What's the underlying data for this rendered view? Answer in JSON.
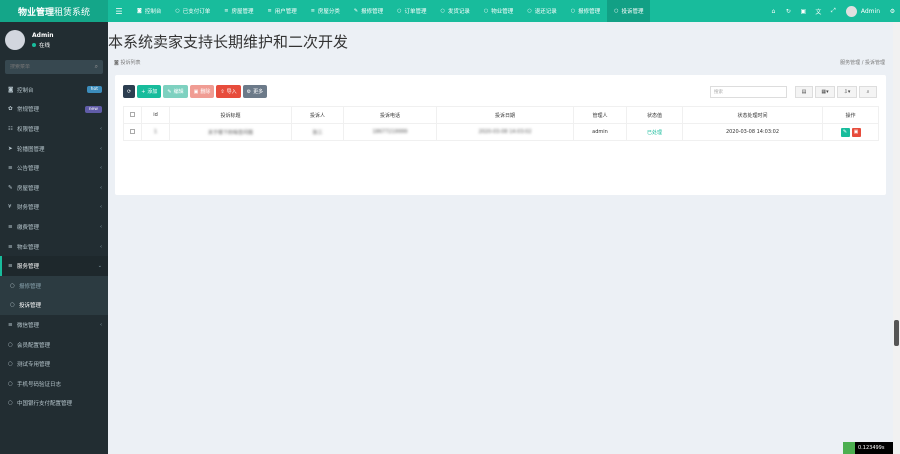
{
  "brand": {
    "bold": "物业管理",
    "light": "租赁系统"
  },
  "topnav": [
    {
      "label": "控制台",
      "icon": "dashboard-icon",
      "glyph": "◙",
      "active": false
    },
    {
      "label": "已支付订单",
      "icon": "circle-icon",
      "glyph": "○",
      "active": false
    },
    {
      "label": "房屋管理",
      "icon": "list-icon",
      "glyph": "≡",
      "active": false
    },
    {
      "label": "用户管理",
      "icon": "list-icon",
      "glyph": "≡",
      "active": false
    },
    {
      "label": "房屋分类",
      "icon": "list-icon",
      "glyph": "≡",
      "active": false
    },
    {
      "label": "报修管理",
      "icon": "wrench-icon",
      "glyph": "✎",
      "active": false
    },
    {
      "label": "订单管理",
      "icon": "circle-icon",
      "glyph": "○",
      "active": false
    },
    {
      "label": "发货记录",
      "icon": "circle-icon",
      "glyph": "○",
      "active": false
    },
    {
      "label": "物业管理",
      "icon": "circle-icon",
      "glyph": "○",
      "active": false
    },
    {
      "label": "退还记录",
      "icon": "circle-icon",
      "glyph": "○",
      "active": false
    },
    {
      "label": "报修管理",
      "icon": "circle-icon",
      "glyph": "○",
      "active": false
    },
    {
      "label": "投诉管理",
      "icon": "circle-icon",
      "glyph": "○",
      "active": true
    }
  ],
  "topright": {
    "username": "Admin"
  },
  "user": {
    "name": "Admin",
    "status": "在线"
  },
  "sidebar_search": {
    "placeholder": "搜索菜单"
  },
  "menu": [
    {
      "label": "控制台",
      "icon": "dashboard-icon",
      "glyph": "◙",
      "badge": "hot",
      "badge_color": "#3c8dbc"
    },
    {
      "label": "常规管理",
      "icon": "cogs-icon",
      "glyph": "✿",
      "badge": "new",
      "badge_color": "#605ca8"
    },
    {
      "label": "权限管理",
      "icon": "group-icon",
      "glyph": "☷",
      "arrow": "‹"
    },
    {
      "label": "轮播图管理",
      "icon": "send-icon",
      "glyph": "➤",
      "arrow": "‹"
    },
    {
      "label": "公告管理",
      "icon": "list-icon",
      "glyph": "≡",
      "arrow": "‹"
    },
    {
      "label": "房屋管理",
      "icon": "wrench-icon",
      "glyph": "✎",
      "arrow": "‹"
    },
    {
      "label": "财务管理",
      "icon": "yen-icon",
      "glyph": "¥",
      "arrow": "‹"
    },
    {
      "label": "缴费管理",
      "icon": "list-icon",
      "glyph": "≡",
      "arrow": "‹"
    },
    {
      "label": "物业管理",
      "icon": "list-icon",
      "glyph": "≡",
      "arrow": "‹"
    },
    {
      "label": "服务管理",
      "icon": "list-icon",
      "glyph": "≡",
      "arrow": "⌄",
      "open": true
    },
    {
      "label": "报修管理",
      "icon": "circle-icon",
      "glyph": "○",
      "sub": true
    },
    {
      "label": "投诉管理",
      "icon": "circle-icon",
      "glyph": "○",
      "sub": true,
      "active": true
    },
    {
      "label": "微信管理",
      "icon": "list-icon",
      "glyph": "≡",
      "arrow": "‹"
    },
    {
      "label": "会员配置管理",
      "icon": "circle-icon",
      "glyph": "○"
    },
    {
      "label": "测试专用管理",
      "icon": "circle-icon",
      "glyph": "○"
    },
    {
      "label": "手机号码验证日志",
      "icon": "circle-icon",
      "glyph": "○"
    },
    {
      "label": "中国银行支付配置管理",
      "icon": "circle-icon",
      "glyph": "○"
    }
  ],
  "page": {
    "title": "本系统卖家支持长期维护和二次开发",
    "sub_left": "投诉列表",
    "breadcrumb": "服务管理 / 投诉管理"
  },
  "toolbar": {
    "refresh": "⟳",
    "add": "添加",
    "edit": "编辑",
    "delete": "删除",
    "import": "导入",
    "more": "更多",
    "search_placeholder": "搜索"
  },
  "colors": {
    "primary": "#18bc9c",
    "dark": "#2c3e50",
    "danger": "#e74c3c",
    "edit_disabled": "#7ed1c0",
    "delete_disabled": "#f09c93"
  },
  "table": {
    "headers": [
      "",
      "id",
      "投诉标题",
      "投诉人",
      "投诉电话",
      "投诉日期",
      "管理人",
      "状态值",
      "状态处理时间",
      "操作"
    ],
    "rows": [
      {
        "id": "1",
        "title": "关于楼下的噪音问题",
        "person": "张三",
        "phone": "18677219999",
        "date": "2020-03-08 14:03:02",
        "manager": "admin",
        "status": "已处理",
        "status_time": "2020-03-08 14:03:02"
      }
    ]
  },
  "trace": "0.123499s"
}
